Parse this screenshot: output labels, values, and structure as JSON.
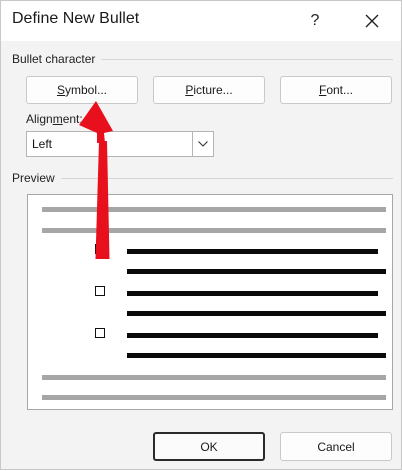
{
  "dialog": {
    "title": "Define New Bullet",
    "help_label": "?",
    "close_icon": "close-icon"
  },
  "bullet_character": {
    "group_label": "Bullet character",
    "symbol_button": {
      "pre": "",
      "underline": "S",
      "post": "ymbol..."
    },
    "picture_button": {
      "pre": "",
      "underline": "P",
      "post": "icture..."
    },
    "font_button": {
      "pre": "",
      "underline": "F",
      "post": "ont..."
    }
  },
  "alignment": {
    "label_pre": "Align",
    "label_underline": "m",
    "label_post": "ent:",
    "value": "Left",
    "dropdown_icon": "chevron-down-icon"
  },
  "preview": {
    "group_label": "Preview",
    "bullet_icon": "empty-square-bullet-icon"
  },
  "footer": {
    "ok_label": "OK",
    "cancel_label": "Cancel"
  },
  "annotation": {
    "arrow_color": "#e8101c"
  }
}
